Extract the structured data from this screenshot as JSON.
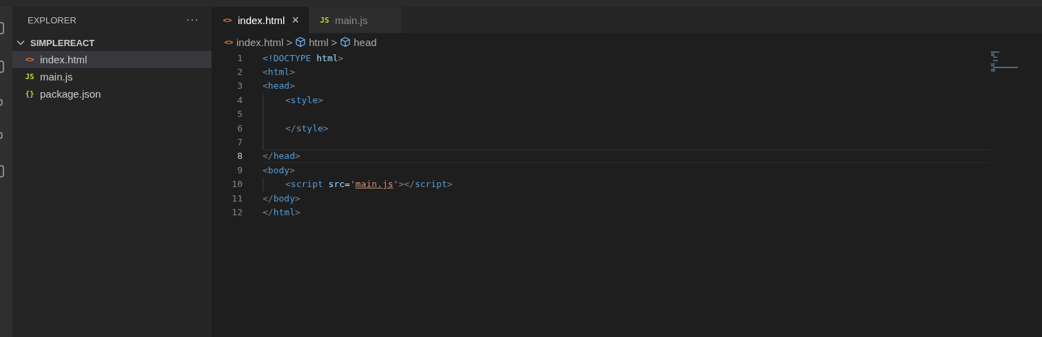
{
  "sidebar": {
    "title": "EXPLORER",
    "more": "···",
    "folder": {
      "name": "SIMPLEREACT",
      "expanded": true,
      "files": [
        {
          "name": "index.html",
          "kind": "html",
          "icon": "<>",
          "selected": true
        },
        {
          "name": "main.js",
          "kind": "js",
          "icon": "JS",
          "selected": false
        },
        {
          "name": "package.json",
          "kind": "json",
          "icon": "{}",
          "selected": false
        }
      ]
    }
  },
  "tabs": [
    {
      "label": "index.html",
      "kind": "html",
      "icon": "<>",
      "selected": true,
      "close": "×"
    },
    {
      "label": "main.js",
      "kind": "js",
      "icon": "JS",
      "selected": false
    }
  ],
  "breadcrumb": [
    {
      "label": "index.html",
      "kind": "file",
      "icon": "<>"
    },
    {
      "label": "html",
      "kind": "symbol"
    },
    {
      "label": "head",
      "kind": "symbol"
    }
  ],
  "separator": ">",
  "lines": [
    {
      "number": "1",
      "indented": false,
      "current": false,
      "tokens": [
        {
          "text": "<!DOCTYPE",
          "kind": "tag"
        },
        {
          "text": " html",
          "kind": "attr"
        },
        {
          "text": ">",
          "kind": "punct"
        }
      ]
    },
    {
      "number": "2",
      "indented": false,
      "current": false,
      "tokens": [
        {
          "text": "<",
          "kind": "punct"
        },
        {
          "text": "html",
          "kind": "tag"
        },
        {
          "text": ">",
          "kind": "punct"
        }
      ]
    },
    {
      "number": "3",
      "indented": false,
      "current": false,
      "tokens": [
        {
          "text": "<",
          "kind": "punct"
        },
        {
          "text": "head",
          "kind": "tag"
        },
        {
          "text": ">",
          "kind": "punct"
        }
      ]
    },
    {
      "number": "4",
      "indented": true,
      "current": false,
      "tokens": [
        {
          "text": "<",
          "kind": "punct"
        },
        {
          "text": "style",
          "kind": "tag"
        },
        {
          "text": ">",
          "kind": "punct"
        }
      ]
    },
    {
      "number": "5",
      "indented": true,
      "current": false
    },
    {
      "number": "6",
      "indented": true,
      "current": false,
      "tokens": [
        {
          "text": "</",
          "kind": "punct"
        },
        {
          "text": "style",
          "kind": "tag"
        },
        {
          "text": ">",
          "kind": "punct"
        }
      ]
    },
    {
      "number": "7",
      "indented": true,
      "current": false
    },
    {
      "number": "8",
      "indented": false,
      "current": true,
      "tokens": [
        {
          "text": "</",
          "kind": "punct"
        },
        {
          "text": "head",
          "kind": "tag"
        },
        {
          "text": ">",
          "kind": "punct"
        }
      ]
    },
    {
      "number": "9",
      "indented": false,
      "current": false,
      "tokens": [
        {
          "text": "<",
          "kind": "punct"
        },
        {
          "text": "body",
          "kind": "tag"
        },
        {
          "text": ">",
          "kind": "punct"
        }
      ]
    },
    {
      "number": "10",
      "indented": true,
      "current": false,
      "tokens": [
        {
          "text": "<",
          "kind": "punct"
        },
        {
          "text": "script",
          "kind": "tag"
        },
        {
          "text": " src",
          "kind": "attr"
        },
        {
          "text": "=",
          "kind": "plain"
        },
        {
          "text": "'",
          "kind": "string"
        },
        {
          "text": "main.js",
          "kind": "link"
        },
        {
          "text": "'",
          "kind": "string"
        },
        {
          "text": "></",
          "kind": "punct"
        },
        {
          "text": "script",
          "kind": "tag"
        },
        {
          "text": ">",
          "kind": "punct"
        }
      ]
    },
    {
      "number": "11",
      "indented": false,
      "current": false,
      "tokens": [
        {
          "text": "</",
          "kind": "punct"
        },
        {
          "text": "body",
          "kind": "tag"
        },
        {
          "text": ">",
          "kind": "punct"
        }
      ]
    },
    {
      "number": "12",
      "indented": false,
      "current": false,
      "tokens": [
        {
          "text": "</",
          "kind": "punct"
        },
        {
          "text": "html",
          "kind": "tag"
        },
        {
          "text": ">",
          "kind": "punct"
        }
      ]
    }
  ]
}
